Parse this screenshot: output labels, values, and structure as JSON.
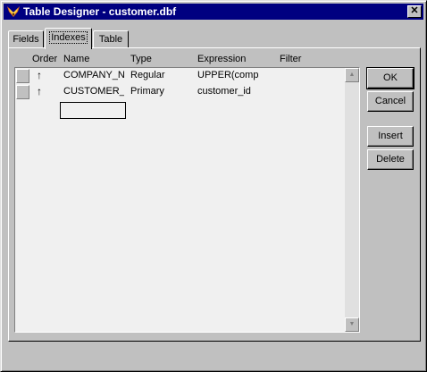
{
  "window": {
    "title": "Table Designer - customer.dbf",
    "close_glyph": "✕"
  },
  "tabs": [
    {
      "label": "Fields",
      "active": false
    },
    {
      "label": "Indexes",
      "active": true
    },
    {
      "label": "Table",
      "active": false
    }
  ],
  "grid": {
    "columns": [
      "Order",
      "Name",
      "Type",
      "Expression",
      "Filter"
    ],
    "rows": [
      {
        "order": "↑",
        "name": "COMPANY_N.",
        "type": "Regular",
        "expression": "UPPER(comp",
        "filter": ""
      },
      {
        "order": "↑",
        "name": "CUSTOMER_",
        "type": "Primary",
        "expression": "customer_id",
        "filter": ""
      }
    ],
    "new_row_name": ""
  },
  "buttons": {
    "ok": "OK",
    "cancel": "Cancel",
    "insert": "Insert",
    "delete": "Delete"
  },
  "icons": {
    "title": "fox-app-icon",
    "scroll_up": "▲",
    "scroll_down": "▼"
  },
  "colors": {
    "titlebar": "#000080",
    "face": "#c0c0c0",
    "grid_background": "#f0f0f0"
  }
}
